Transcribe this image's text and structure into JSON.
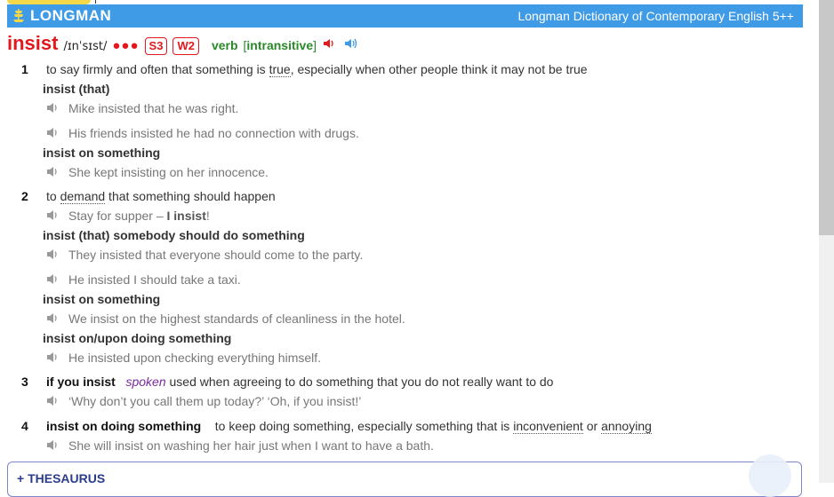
{
  "banner": {
    "brand": "LONGMAN",
    "title": "Longman Dictionary of Contemporary English 5++"
  },
  "entry": {
    "headword": "insist",
    "pronunciation": "/ɪnˈsɪst/",
    "frequency_dots": "●●●",
    "badges": [
      "S3",
      "W2"
    ],
    "pos": "verb",
    "grammar_open": "[",
    "grammar": "intransitive",
    "grammar_close": "]"
  },
  "senses": [
    {
      "num": "1",
      "def_pre": "to say firmly and often that something is ",
      "def_link": "true",
      "def_post": ", especially when other people think it may not be true"
    },
    {
      "num": "2",
      "def_pre": "to ",
      "def_link": "demand",
      "def_post": " that something should happen"
    },
    {
      "num": "3",
      "signpost": "if you insist",
      "register": "spoken",
      "def": " used when agreeing to do something that you do not really want to do"
    },
    {
      "num": "4",
      "signpost": "insist on doing something",
      "def_pre": "to keep doing something, especially something that is ",
      "def_link1": "inconvenient",
      "def_mid": " or ",
      "def_link2": "annoying"
    }
  ],
  "patterns": [
    "insist (that)",
    "insist on something",
    "insist (that) somebody should do something",
    "insist on something",
    "insist on/upon doing something"
  ],
  "examples": [
    "Mike insisted that he was right.",
    "His friends insisted he had no connection with drugs.",
    "She kept insisting on her innocence.",
    "Stay for supper – ",
    "I insist",
    "!",
    "They insisted that everyone should come to the party.",
    "He insisted I should take a taxi.",
    "We insist on the highest standards of cleanliness in the hotel.",
    "He insisted upon checking everything himself.",
    "‘Why don’t you call them up today?’ ‘Oh, if you insist!’",
    "She will insist on washing her hair just when I want to have a bath."
  ],
  "thesaurus": {
    "label": "+ THESAURUS"
  },
  "colors": {
    "banner": "#3f9be6",
    "headword": "#e3171c",
    "pos": "#2a8a2a",
    "register": "#7a2a9a",
    "thesaurus": "#2b3c8a"
  }
}
